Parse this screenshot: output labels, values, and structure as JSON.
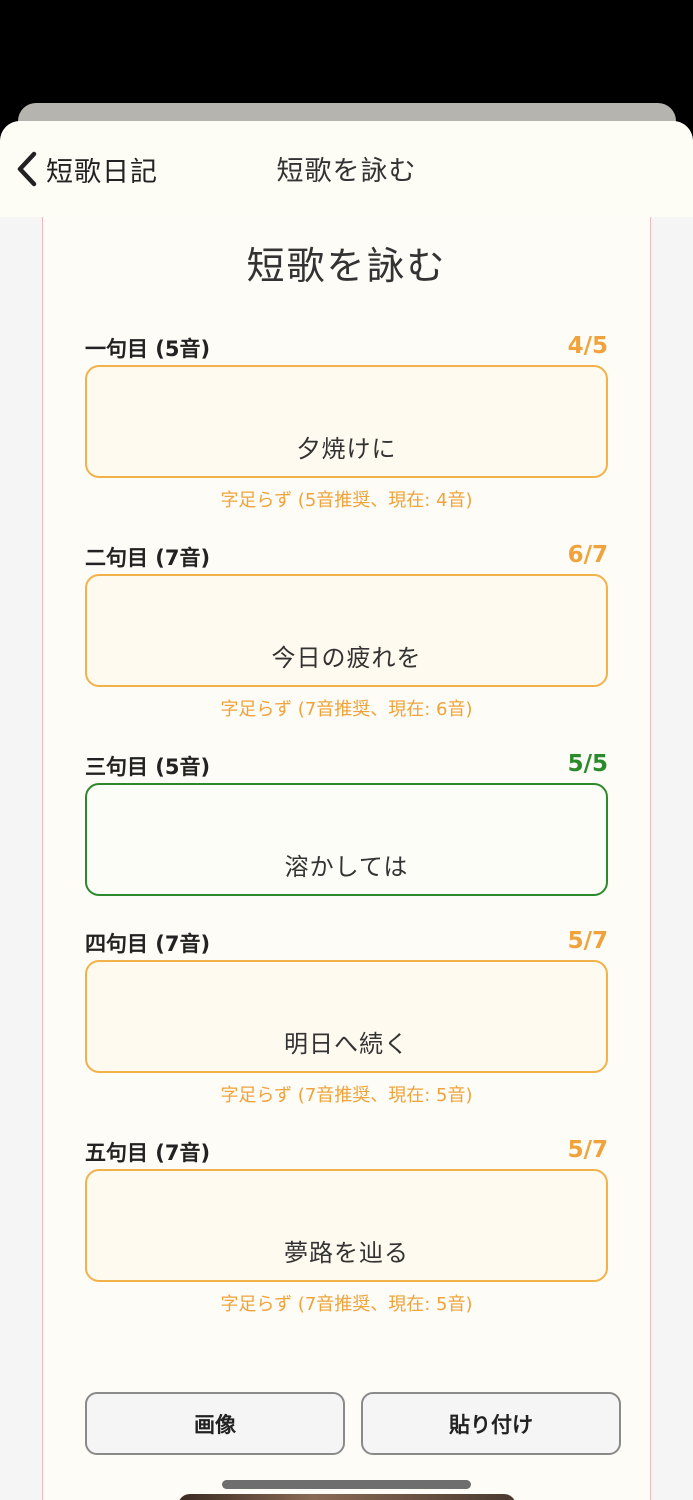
{
  "nav": {
    "back_label": "短歌日記",
    "title": "短歌を詠む"
  },
  "page": {
    "title": "短歌を詠む"
  },
  "verses": [
    {
      "label": "一句目 (5音)",
      "count": "4/5",
      "text": "夕焼けに",
      "status": "short",
      "warning": "字足らず (5音推奨、現在: 4音)"
    },
    {
      "label": "二句目 (7音)",
      "count": "6/7",
      "text": "今日の疲れを",
      "status": "short",
      "warning": "字足らず (7音推奨、現在: 6音)"
    },
    {
      "label": "三句目 (5音)",
      "count": "5/5",
      "text": "溶かしては",
      "status": "ok",
      "warning": ""
    },
    {
      "label": "四句目 (7音)",
      "count": "5/7",
      "text": "明日へ続く",
      "status": "short",
      "warning": "字足らず (7音推奨、現在: 5音)"
    },
    {
      "label": "五句目 (7音)",
      "count": "5/7",
      "text": "夢路を辿る",
      "status": "short",
      "warning": "字足らず (7音推奨、現在: 5音)"
    }
  ],
  "buttons": {
    "image_label": "画像",
    "paste_label": "貼り付け"
  },
  "colors": {
    "warning": "#f0a33c",
    "ok": "#2c8a2c",
    "paper_border": "#f3b8c0"
  },
  "icons": {
    "back": "chevron-left-icon"
  }
}
